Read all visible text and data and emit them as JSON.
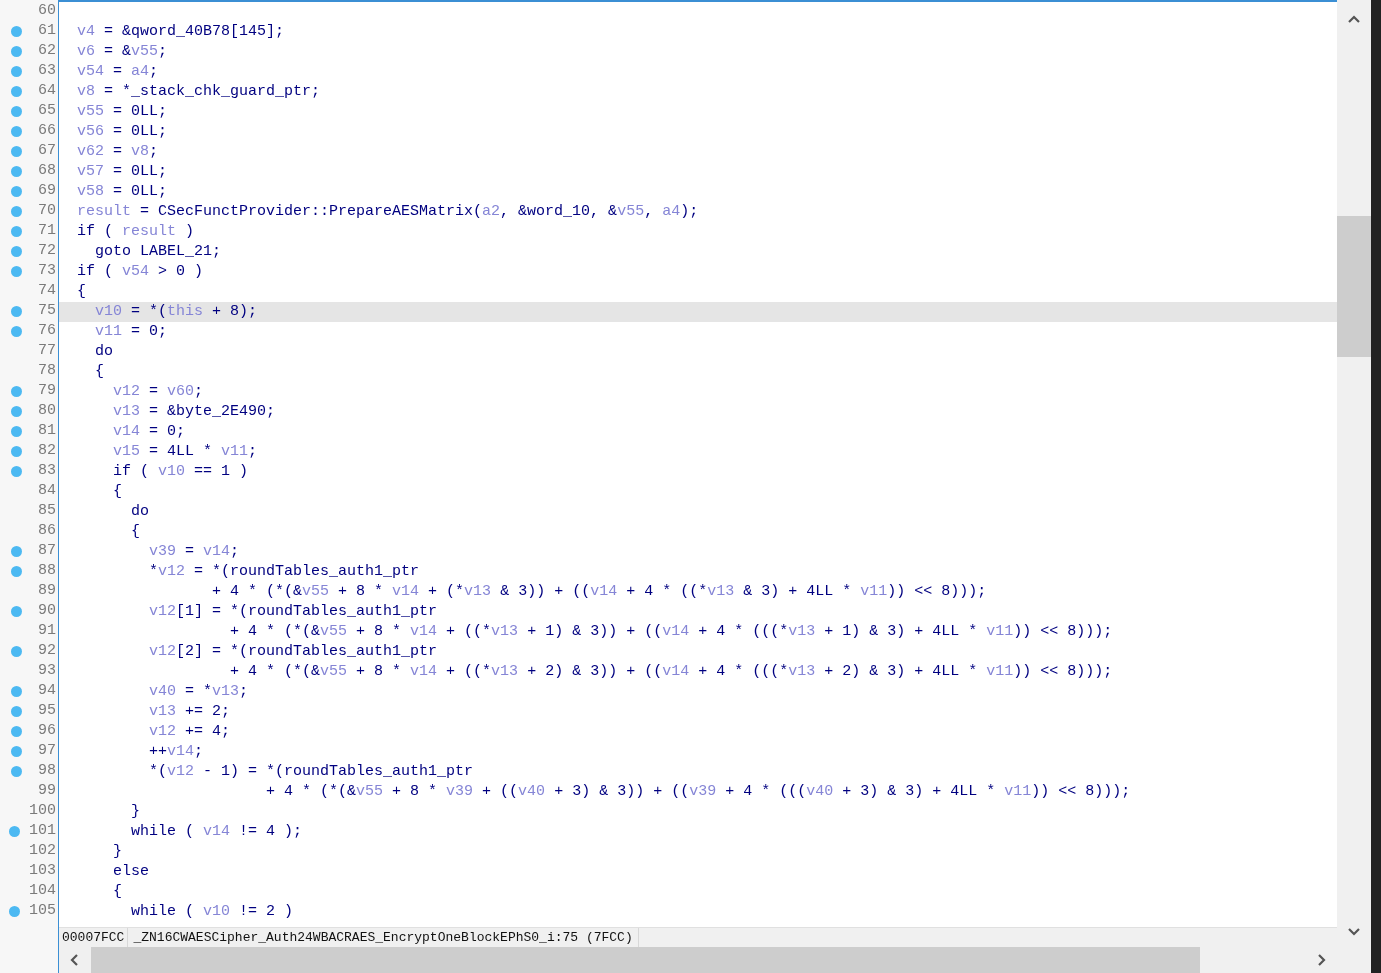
{
  "lines": [
    {
      "number": "60",
      "breakpoint": false,
      "selected": false
    },
    {
      "number": "61",
      "breakpoint": true,
      "selected": false,
      "segments": [
        {
          "text": "v4",
          "kind": "var"
        },
        {
          "text": " = &qword_40B78[145];",
          "kind": "code"
        }
      ]
    },
    {
      "number": "62",
      "breakpoint": true,
      "selected": false,
      "segments": [
        {
          "text": "v6",
          "kind": "var"
        },
        {
          "text": " = &",
          "kind": "code"
        },
        {
          "text": "v55",
          "kind": "var"
        },
        {
          "text": ";",
          "kind": "code"
        }
      ]
    },
    {
      "number": "63",
      "breakpoint": true,
      "selected": false,
      "segments": [
        {
          "text": "v54",
          "kind": "var"
        },
        {
          "text": " = ",
          "kind": "code"
        },
        {
          "text": "a4",
          "kind": "var"
        },
        {
          "text": ";",
          "kind": "code"
        }
      ]
    },
    {
      "number": "64",
      "breakpoint": true,
      "selected": false,
      "segments": [
        {
          "text": "v8",
          "kind": "var"
        },
        {
          "text": " = *_stack_chk_guard_ptr;",
          "kind": "code"
        }
      ]
    },
    {
      "number": "65",
      "breakpoint": true,
      "selected": false,
      "segments": [
        {
          "text": "v55",
          "kind": "var"
        },
        {
          "text": " = 0LL;",
          "kind": "code"
        }
      ]
    },
    {
      "number": "66",
      "breakpoint": true,
      "selected": false,
      "segments": [
        {
          "text": "v56",
          "kind": "var"
        },
        {
          "text": " = 0LL;",
          "kind": "code"
        }
      ]
    },
    {
      "number": "67",
      "breakpoint": true,
      "selected": false,
      "segments": [
        {
          "text": "v62",
          "kind": "var"
        },
        {
          "text": " = ",
          "kind": "code"
        },
        {
          "text": "v8",
          "kind": "var"
        },
        {
          "text": ";",
          "kind": "code"
        }
      ]
    },
    {
      "number": "68",
      "breakpoint": true,
      "selected": false,
      "segments": [
        {
          "text": "v57",
          "kind": "var"
        },
        {
          "text": " = 0LL;",
          "kind": "code"
        }
      ]
    },
    {
      "number": "69",
      "breakpoint": true,
      "selected": false,
      "segments": [
        {
          "text": "v58",
          "kind": "var"
        },
        {
          "text": " = 0LL;",
          "kind": "code"
        }
      ]
    },
    {
      "number": "70",
      "breakpoint": true,
      "selected": false,
      "segments": [
        {
          "text": "result",
          "kind": "var"
        },
        {
          "text": " = CSecFunctProvider::PrepareAESMatrix(",
          "kind": "code"
        },
        {
          "text": "a2",
          "kind": "var"
        },
        {
          "text": ", &word_10, &",
          "kind": "code"
        },
        {
          "text": "v55",
          "kind": "var"
        },
        {
          "text": ", ",
          "kind": "code"
        },
        {
          "text": "a4",
          "kind": "var"
        },
        {
          "text": ");",
          "kind": "code"
        }
      ]
    },
    {
      "number": "71",
      "breakpoint": true,
      "selected": false,
      "segments": [
        {
          "text": "if ( ",
          "kind": "code"
        },
        {
          "text": "result",
          "kind": "var"
        },
        {
          "text": " )",
          "kind": "code"
        }
      ]
    },
    {
      "number": "72",
      "breakpoint": true,
      "selected": false,
      "segments": [
        {
          "text": "  goto LABEL_21;",
          "kind": "code"
        }
      ]
    },
    {
      "number": "73",
      "breakpoint": true,
      "selected": false,
      "segments": [
        {
          "text": "if ( ",
          "kind": "code"
        },
        {
          "text": "v54",
          "kind": "var"
        },
        {
          "text": " > 0 )",
          "kind": "code"
        }
      ]
    },
    {
      "number": "74",
      "breakpoint": false,
      "selected": false,
      "segments": [
        {
          "text": "{",
          "kind": "code"
        }
      ]
    },
    {
      "number": "75",
      "breakpoint": true,
      "selected": true,
      "segments": [
        {
          "text": "  v10",
          "kind": "var"
        },
        {
          "text": " = *(",
          "kind": "code"
        },
        {
          "text": "this",
          "kind": "var"
        },
        {
          "text": " + 8);",
          "kind": "code"
        }
      ]
    },
    {
      "number": "76",
      "breakpoint": true,
      "selected": false,
      "segments": [
        {
          "text": "  v11",
          "kind": "var"
        },
        {
          "text": " = 0;",
          "kind": "code"
        }
      ]
    },
    {
      "number": "77",
      "breakpoint": false,
      "selected": false,
      "segments": [
        {
          "text": "  do",
          "kind": "code"
        }
      ]
    },
    {
      "number": "78",
      "breakpoint": false,
      "selected": false,
      "segments": [
        {
          "text": "  {",
          "kind": "code"
        }
      ]
    },
    {
      "number": "79",
      "breakpoint": true,
      "selected": false,
      "segments": [
        {
          "text": "    v12",
          "kind": "var"
        },
        {
          "text": " = ",
          "kind": "code"
        },
        {
          "text": "v60",
          "kind": "var"
        },
        {
          "text": ";",
          "kind": "code"
        }
      ]
    },
    {
      "number": "80",
      "breakpoint": true,
      "selected": false,
      "segments": [
        {
          "text": "    v13",
          "kind": "var"
        },
        {
          "text": " = &byte_2E490;",
          "kind": "code"
        }
      ]
    },
    {
      "number": "81",
      "breakpoint": true,
      "selected": false,
      "segments": [
        {
          "text": "    v14",
          "kind": "var"
        },
        {
          "text": " = 0;",
          "kind": "code"
        }
      ]
    },
    {
      "number": "82",
      "breakpoint": true,
      "selected": false,
      "segments": [
        {
          "text": "    v15",
          "kind": "var"
        },
        {
          "text": " = 4LL * ",
          "kind": "code"
        },
        {
          "text": "v11",
          "kind": "var"
        },
        {
          "text": ";",
          "kind": "code"
        }
      ]
    },
    {
      "number": "83",
      "breakpoint": true,
      "selected": false,
      "segments": [
        {
          "text": "    if ( ",
          "kind": "code"
        },
        {
          "text": "v10",
          "kind": "var"
        },
        {
          "text": " == 1 )",
          "kind": "code"
        }
      ]
    },
    {
      "number": "84",
      "breakpoint": false,
      "selected": false,
      "segments": [
        {
          "text": "    {",
          "kind": "code"
        }
      ]
    },
    {
      "number": "85",
      "breakpoint": false,
      "selected": false,
      "segments": [
        {
          "text": "      do",
          "kind": "code"
        }
      ]
    },
    {
      "number": "86",
      "breakpoint": false,
      "selected": false,
      "segments": [
        {
          "text": "      {",
          "kind": "code"
        }
      ]
    },
    {
      "number": "87",
      "breakpoint": true,
      "selected": false,
      "segments": [
        {
          "text": "        v39",
          "kind": "var"
        },
        {
          "text": " = ",
          "kind": "code"
        },
        {
          "text": "v14",
          "kind": "var"
        },
        {
          "text": ";",
          "kind": "code"
        }
      ]
    },
    {
      "number": "88",
      "breakpoint": true,
      "selected": false,
      "segments": [
        {
          "text": "        *",
          "kind": "code"
        },
        {
          "text": "v12",
          "kind": "var"
        },
        {
          "text": " = *(roundTables_auth1_ptr",
          "kind": "code"
        }
      ]
    },
    {
      "number": "89",
      "breakpoint": false,
      "selected": false,
      "segments": [
        {
          "text": "               + 4 * (*(&",
          "kind": "code"
        },
        {
          "text": "v55",
          "kind": "var"
        },
        {
          "text": " + 8 * ",
          "kind": "code"
        },
        {
          "text": "v14",
          "kind": "var"
        },
        {
          "text": " + (*",
          "kind": "code"
        },
        {
          "text": "v13",
          "kind": "var"
        },
        {
          "text": " & 3)) + ((",
          "kind": "code"
        },
        {
          "text": "v14",
          "kind": "var"
        },
        {
          "text": " + 4 * ((*",
          "kind": "code"
        },
        {
          "text": "v13",
          "kind": "var"
        },
        {
          "text": " & 3) + 4LL * ",
          "kind": "code"
        },
        {
          "text": "v11",
          "kind": "var"
        },
        {
          "text": ")) << 8)));",
          "kind": "code"
        }
      ]
    },
    {
      "number": "90",
      "breakpoint": true,
      "selected": false,
      "segments": [
        {
          "text": "        v12",
          "kind": "var"
        },
        {
          "text": "[1] = *(roundTables_auth1_ptr",
          "kind": "code"
        }
      ]
    },
    {
      "number": "91",
      "breakpoint": false,
      "selected": false,
      "segments": [
        {
          "text": "                 + 4 * (*(&",
          "kind": "code"
        },
        {
          "text": "v55",
          "kind": "var"
        },
        {
          "text": " + 8 * ",
          "kind": "code"
        },
        {
          "text": "v14",
          "kind": "var"
        },
        {
          "text": " + ((*",
          "kind": "code"
        },
        {
          "text": "v13",
          "kind": "var"
        },
        {
          "text": " + 1) & 3)) + ((",
          "kind": "code"
        },
        {
          "text": "v14",
          "kind": "var"
        },
        {
          "text": " + 4 * (((*",
          "kind": "code"
        },
        {
          "text": "v13",
          "kind": "var"
        },
        {
          "text": " + 1) & 3) + 4LL * ",
          "kind": "code"
        },
        {
          "text": "v11",
          "kind": "var"
        },
        {
          "text": ")) << 8)));",
          "kind": "code"
        }
      ]
    },
    {
      "number": "92",
      "breakpoint": true,
      "selected": false,
      "segments": [
        {
          "text": "        v12",
          "kind": "var"
        },
        {
          "text": "[2] = *(roundTables_auth1_ptr",
          "kind": "code"
        }
      ]
    },
    {
      "number": "93",
      "breakpoint": false,
      "selected": false,
      "segments": [
        {
          "text": "                 + 4 * (*(&",
          "kind": "code"
        },
        {
          "text": "v55",
          "kind": "var"
        },
        {
          "text": " + 8 * ",
          "kind": "code"
        },
        {
          "text": "v14",
          "kind": "var"
        },
        {
          "text": " + ((*",
          "kind": "code"
        },
        {
          "text": "v13",
          "kind": "var"
        },
        {
          "text": " + 2) & 3)) + ((",
          "kind": "code"
        },
        {
          "text": "v14",
          "kind": "var"
        },
        {
          "text": " + 4 * (((*",
          "kind": "code"
        },
        {
          "text": "v13",
          "kind": "var"
        },
        {
          "text": " + 2) & 3) + 4LL * ",
          "kind": "code"
        },
        {
          "text": "v11",
          "kind": "var"
        },
        {
          "text": ")) << 8)));",
          "kind": "code"
        }
      ]
    },
    {
      "number": "94",
      "breakpoint": true,
      "selected": false,
      "segments": [
        {
          "text": "        v40",
          "kind": "var"
        },
        {
          "text": " = *",
          "kind": "code"
        },
        {
          "text": "v13",
          "kind": "var"
        },
        {
          "text": ";",
          "kind": "code"
        }
      ]
    },
    {
      "number": "95",
      "breakpoint": true,
      "selected": false,
      "segments": [
        {
          "text": "        v13",
          "kind": "var"
        },
        {
          "text": " += 2;",
          "kind": "code"
        }
      ]
    },
    {
      "number": "96",
      "breakpoint": true,
      "selected": false,
      "segments": [
        {
          "text": "        v12",
          "kind": "var"
        },
        {
          "text": " += 4;",
          "kind": "code"
        }
      ]
    },
    {
      "number": "97",
      "breakpoint": true,
      "selected": false,
      "segments": [
        {
          "text": "        ++",
          "kind": "code"
        },
        {
          "text": "v14",
          "kind": "var"
        },
        {
          "text": ";",
          "kind": "code"
        }
      ]
    },
    {
      "number": "98",
      "breakpoint": true,
      "selected": false,
      "segments": [
        {
          "text": "        *(",
          "kind": "code"
        },
        {
          "text": "v12",
          "kind": "var"
        },
        {
          "text": " - 1) = *(roundTables_auth1_ptr",
          "kind": "code"
        }
      ]
    },
    {
      "number": "99",
      "breakpoint": false,
      "selected": false,
      "segments": [
        {
          "text": "                     + 4 * (*(&",
          "kind": "code"
        },
        {
          "text": "v55",
          "kind": "var"
        },
        {
          "text": " + 8 * ",
          "kind": "code"
        },
        {
          "text": "v39",
          "kind": "var"
        },
        {
          "text": " + ((",
          "kind": "code"
        },
        {
          "text": "v40",
          "kind": "var"
        },
        {
          "text": " + 3) & 3)) + ((",
          "kind": "code"
        },
        {
          "text": "v39",
          "kind": "var"
        },
        {
          "text": " + 4 * (((",
          "kind": "code"
        },
        {
          "text": "v40",
          "kind": "var"
        },
        {
          "text": " + 3) & 3) + 4LL * ",
          "kind": "code"
        },
        {
          "text": "v11",
          "kind": "var"
        },
        {
          "text": ")) << 8)));",
          "kind": "code"
        }
      ]
    },
    {
      "number": "100",
      "breakpoint": false,
      "selected": false,
      "segments": [
        {
          "text": "      }",
          "kind": "code"
        }
      ]
    },
    {
      "number": "101",
      "breakpoint": true,
      "selected": false,
      "segments": [
        {
          "text": "      while ( ",
          "kind": "code"
        },
        {
          "text": "v14",
          "kind": "var"
        },
        {
          "text": " != 4 );",
          "kind": "code"
        }
      ]
    },
    {
      "number": "102",
      "breakpoint": false,
      "selected": false,
      "segments": [
        {
          "text": "    }",
          "kind": "code"
        }
      ]
    },
    {
      "number": "103",
      "breakpoint": false,
      "selected": false,
      "segments": [
        {
          "text": "    else",
          "kind": "code"
        }
      ]
    },
    {
      "number": "104",
      "breakpoint": false,
      "selected": false,
      "segments": [
        {
          "text": "    {",
          "kind": "code"
        }
      ]
    },
    {
      "number": "105",
      "breakpoint": true,
      "selected": false,
      "segments": [
        {
          "text": "      while ( ",
          "kind": "code"
        },
        {
          "text": "v10",
          "kind": "var"
        },
        {
          "text": " != 2 )",
          "kind": "code"
        }
      ]
    }
  ],
  "status_bar": {
    "address": "00007FCC",
    "location": "_ZN16CWAESCipher_Auth24WBACRAES_EncryptOneBlockEPhS0_i:75 (7FCC)"
  }
}
